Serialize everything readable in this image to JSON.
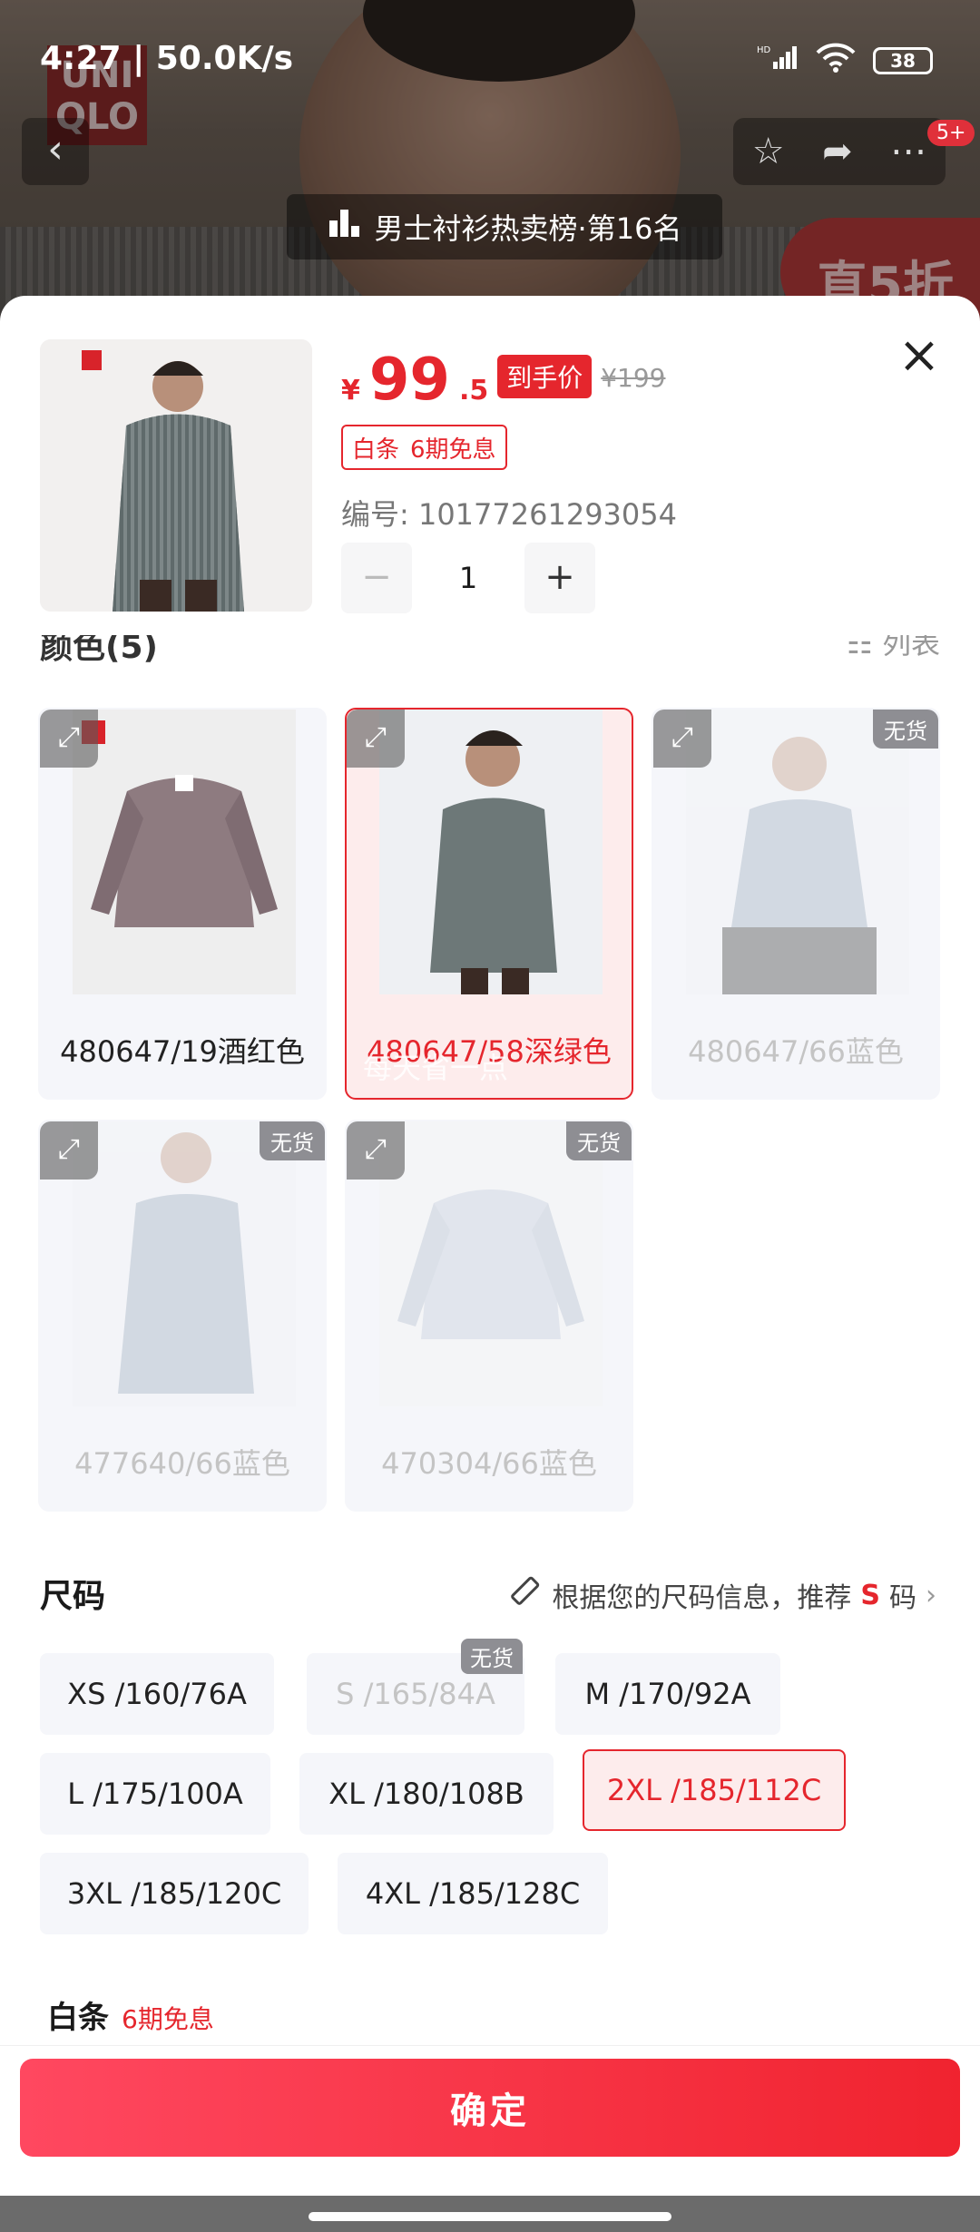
{
  "status_bar": {
    "time": "4:27 | 50.0K/s",
    "network": "HD",
    "battery": "38"
  },
  "background": {
    "brand_logo": "UNIQLO",
    "rank_text": "男士衬衫热卖榜·第16名",
    "notification_count": "5+",
    "discount_text": "直5折"
  },
  "header": {
    "price_symbol": "¥",
    "price_int": "99",
    "price_dec": ".5",
    "hand_price_label": "到手价",
    "original_price": "¥199",
    "baitiao_label": "白条",
    "baitiao_promo": "6期免息",
    "sku_number": "编号: 10177261293054",
    "quantity": "1",
    "minus": "−",
    "plus": "+"
  },
  "color_section": {
    "title": "颜色(5)",
    "list_toggle": "列表",
    "items": [
      {
        "label": "480647/19酒红色",
        "state": "normal"
      },
      {
        "label": "480647/58深绿色",
        "state": "selected"
      },
      {
        "label": "480647/66蓝色",
        "state": "out_of_stock"
      },
      {
        "label": "477640/66蓝色",
        "state": "out_of_stock"
      },
      {
        "label": "470304/66蓝色",
        "state": "out_of_stock"
      }
    ],
    "oos_badge": "无货",
    "watermark": "每天省一点"
  },
  "size_section": {
    "title": "尺码",
    "recommend_prefix": "根据您的尺码信息，推荐",
    "recommend_size": "S",
    "recommend_suffix": "码",
    "oos_badge": "无货",
    "sizes": [
      {
        "label": "XS /160/76A",
        "state": "normal"
      },
      {
        "label": "S /165/84A",
        "state": "out_of_stock"
      },
      {
        "label": "M /170/92A",
        "state": "normal"
      },
      {
        "label": "L /175/100A",
        "state": "normal"
      },
      {
        "label": "XL /180/108B",
        "state": "normal"
      },
      {
        "label": "2XL /185/112C",
        "state": "selected"
      },
      {
        "label": "3XL /185/120C",
        "state": "normal"
      },
      {
        "label": "4XL /185/128C",
        "state": "normal"
      }
    ]
  },
  "payment": {
    "label": "白条",
    "promo": "6期免息"
  },
  "footer": {
    "confirm_label": "确定"
  },
  "colors": {
    "accent": "#e5262d",
    "chip_bg": "#f5f6fa",
    "oos_text": "#c4c4c4"
  }
}
